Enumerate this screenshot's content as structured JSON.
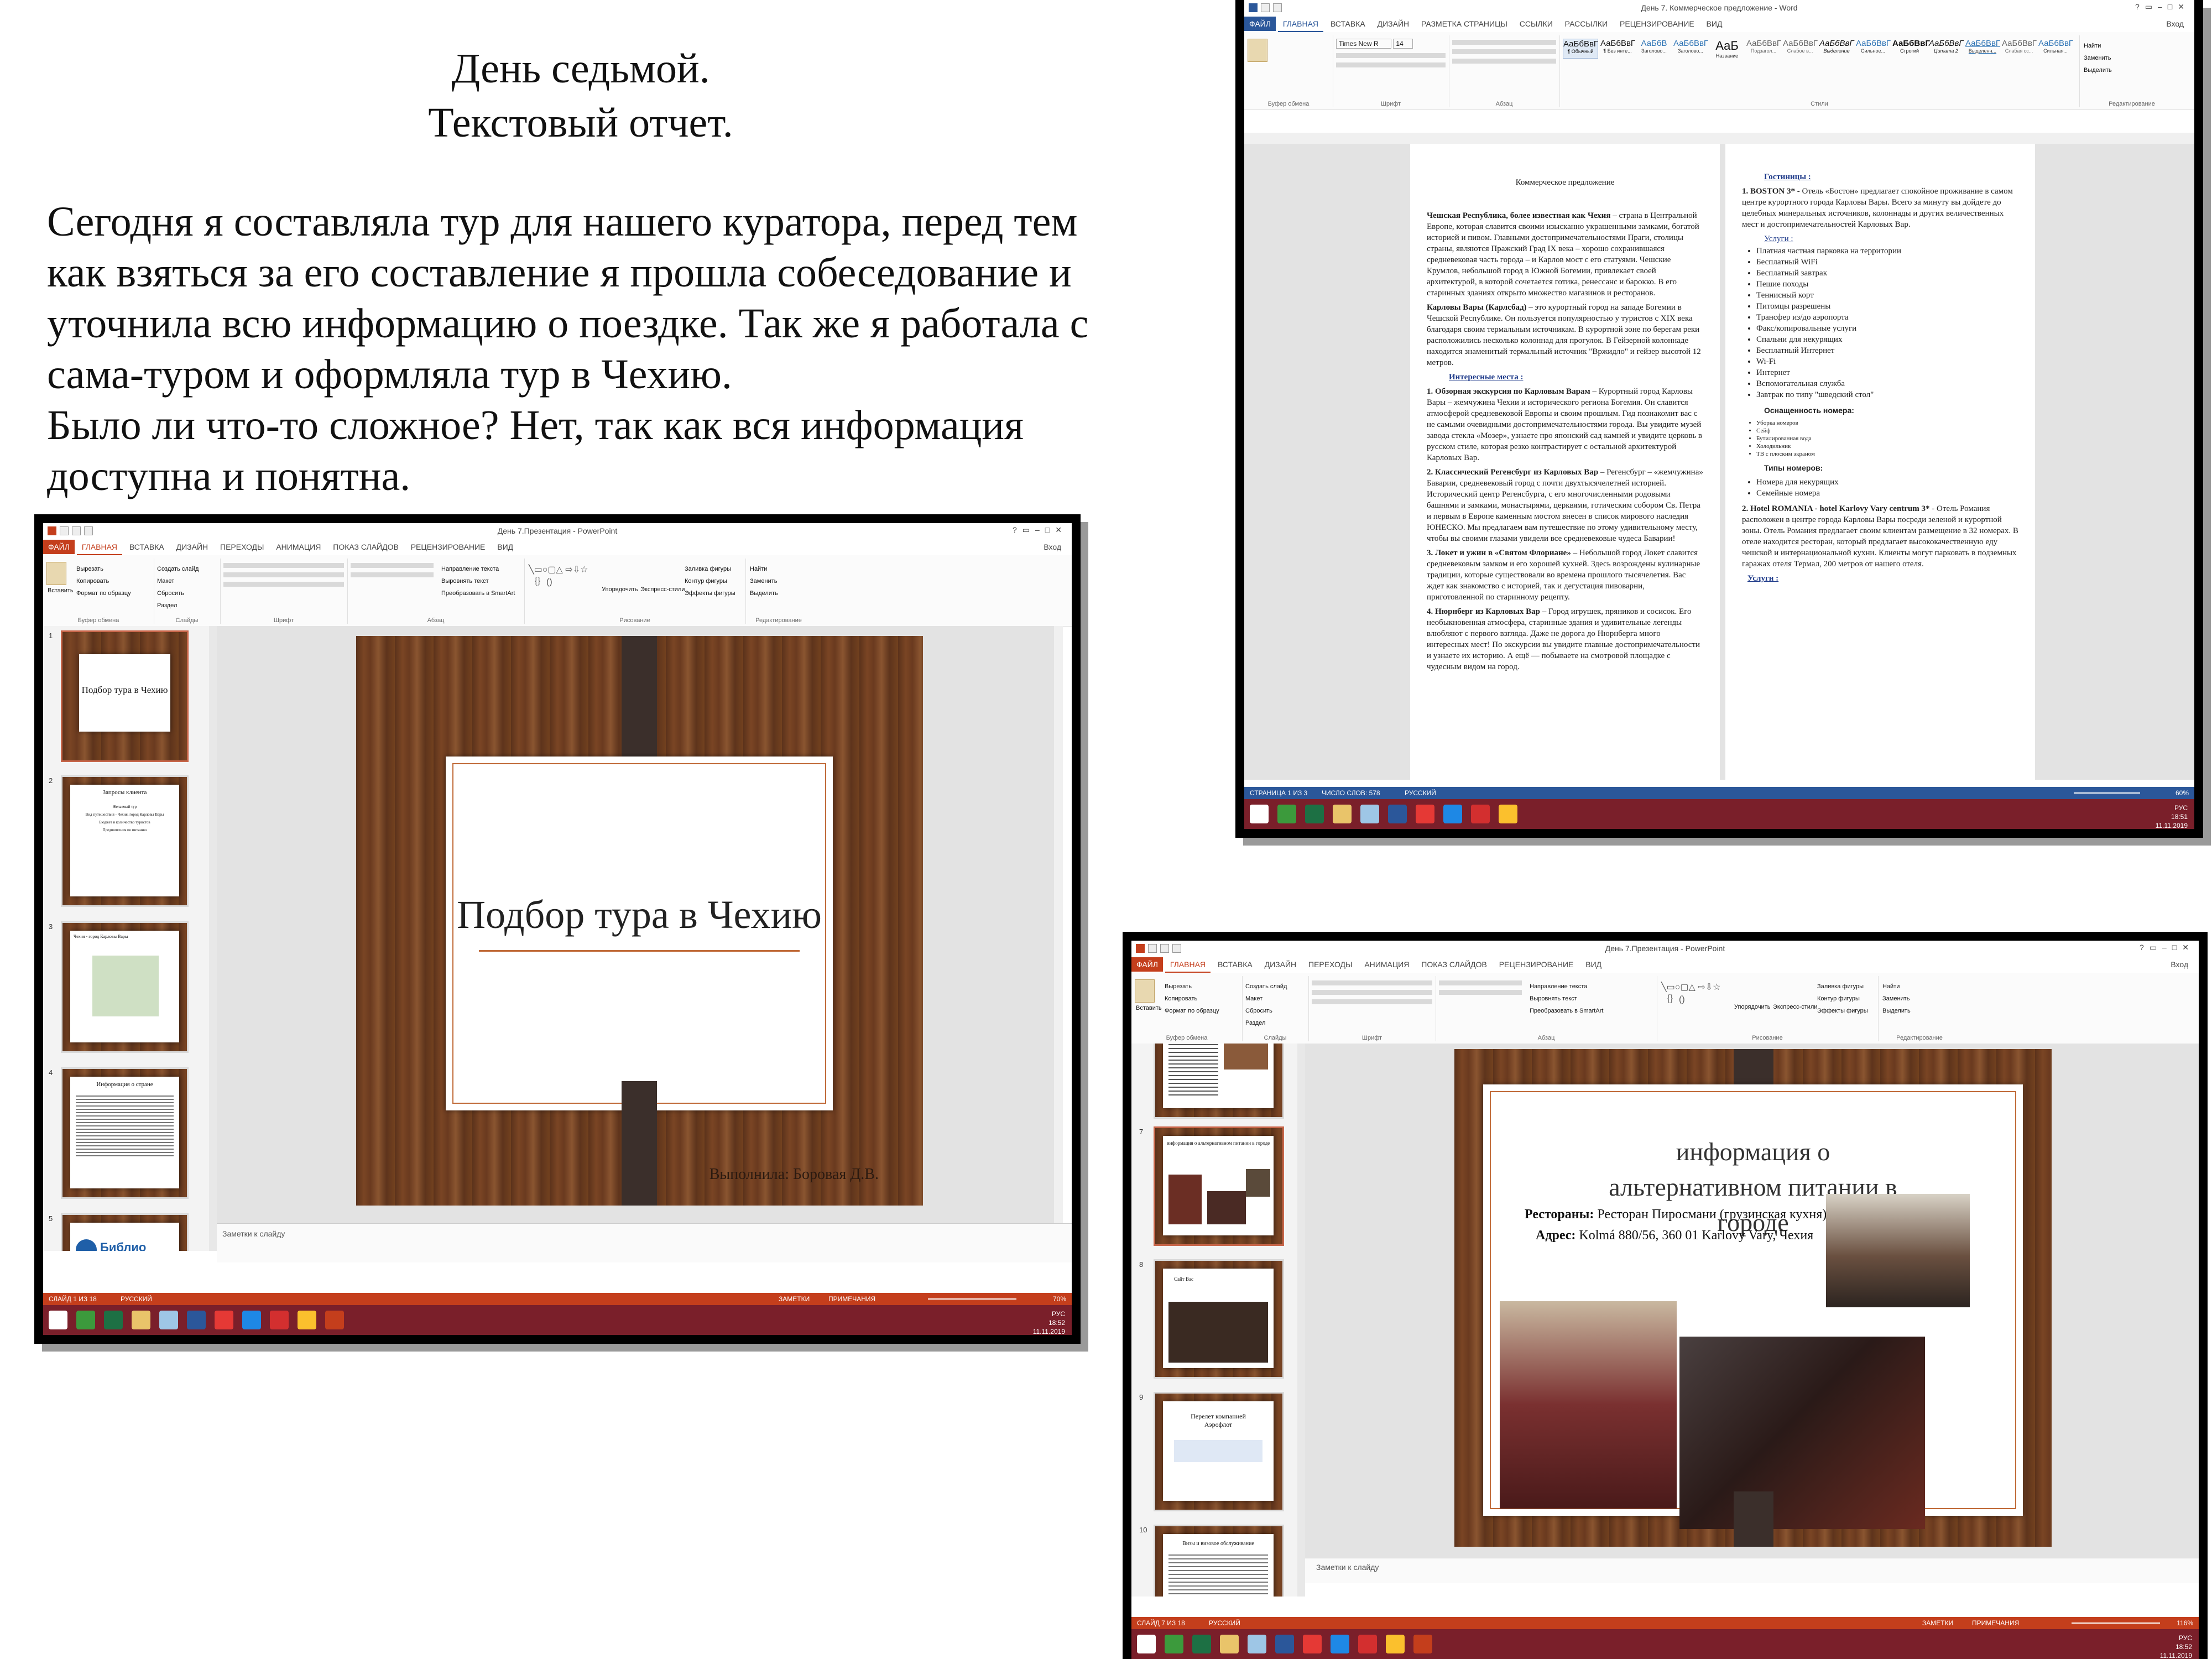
{
  "heading": {
    "line1": "День седьмой.",
    "line2": "Текстовый отчет."
  },
  "report": {
    "p1": "Сегодня я составляла тур для нашего куратора, перед тем как взяться за его составление я прошла собеседование и уточнила всю информацию о поездке. Так же я работала с сама-туром и оформляла тур в Чехию.",
    "p2": "Было ли что-то сложное? Нет, так как вся информация доступна и понятна."
  },
  "ppt1": {
    "window_title": "День 7.Презентация - PowerPoint",
    "tabs": [
      "ФАЙЛ",
      "ГЛАВНАЯ",
      "ВСТАВКА",
      "ДИЗАЙН",
      "ПЕРЕХОДЫ",
      "АНИМАЦИЯ",
      "ПОКАЗ СЛАЙДОВ",
      "РЕЦЕНЗИРОВАНИЕ",
      "ВИД"
    ],
    "login": "Вход",
    "ribbon_groups": [
      "Буфер обмена",
      "Слайды",
      "Шрифт",
      "Абзац",
      "Рисование",
      "Редактирование"
    ],
    "clipboard": [
      "Вставить",
      "Вырезать",
      "Копировать",
      "Формат по образцу"
    ],
    "slides_group": [
      "Создать слайд",
      "Макет",
      "Сбросить",
      "Раздел"
    ],
    "paragraph_group": [
      "Направление текста",
      "Выровнять текст",
      "Преобразовать в SmartArt"
    ],
    "drawing_group": [
      "Упорядочить",
      "Экспресс-стили",
      "Заливка фигуры",
      "Контур фигуры",
      "Эффекты фигуры"
    ],
    "editing_group": [
      "Найти",
      "Заменить",
      "Выделить"
    ],
    "thumbs": [
      {
        "num": "1",
        "title": "Подбор тура в Чехию"
      },
      {
        "num": "2",
        "title": "Запросы клиента"
      },
      {
        "num": "3",
        "title": "Чехия - город Карловы Вары"
      },
      {
        "num": "4",
        "title": "Информация о стране"
      },
      {
        "num": "5",
        "title": "Библио"
      }
    ],
    "thumb2_lines": [
      "Желаемый тур",
      "Вид путешествия - Чехия, город Карловы Вары",
      "Бюджет и количество туристов",
      "Предпочтения по питанию"
    ],
    "slide_title": "Подбор тура в Чехию",
    "slide_author": "Выполнила: Боровая Д.В.",
    "notes": "Заметки к слайду",
    "status_left": "СЛАЙД 1 ИЗ 18",
    "status_lang": "РУССКИЙ",
    "status_notes": "ЗАМЕТКИ",
    "status_comments": "ПРИМЕЧАНИЯ",
    "zoom": "70%",
    "clock_time": "18:52",
    "clock_date": "11.11.2019",
    "lang_indicator": "РУС"
  },
  "word": {
    "window_title": "День 7. Коммерческое предложение - Word",
    "tabs": [
      "ФАЙЛ",
      "ГЛАВНАЯ",
      "ВСТАВКА",
      "ДИЗАЙН",
      "РАЗМЕТКА СТРАНИЦЫ",
      "ССЫЛКИ",
      "РАССЫЛКИ",
      "РЕЦЕНЗИРОВАНИЕ",
      "ВИД"
    ],
    "login": "Вход",
    "font_name": "Times New R",
    "font_size": "14",
    "ribbon_groups": [
      "Буфер обмена",
      "Шрифт",
      "Абзац",
      "Стили",
      "Редактирование"
    ],
    "styles": [
      "АаБбВвГ",
      "АаБбВвГ",
      "АаБбВ",
      "АаБбВвГ",
      "АаБ",
      "АаБбВвГ",
      "АаБбВвГ",
      "АаБбВвГ",
      "АаБбВвГ",
      "АаБбВвГ",
      "АаБбВвГ",
      "АаБбВвГ",
      "АаБбВвГ",
      "АаБбВвГ"
    ],
    "style_names": [
      "¶ Обычный",
      "¶ Без инте...",
      "Заголово...",
      "Заголово...",
      "Название",
      "Подзагол...",
      "Слабое в...",
      "Выделение",
      "Сильное...",
      "Строгий",
      "Цитата 2",
      "Выделенн...",
      "Слабая сс...",
      "Сильная..."
    ],
    "editing": [
      "Найти",
      "Заменить",
      "Выделить"
    ],
    "left_page": {
      "heading": "Коммерческое предложение",
      "p1_bold": "Чешская Республика, более известная как Чехия",
      "p1": " – страна в Центральной Европе, которая славится своими изысканно украшенными замками, богатой историей и пивом. Главными достопримечательностями Праги, столицы страны, являются Пражский Град IX века – хорошо сохранившаяся средневековая часть города – и Карлов мост с его статуями. Чешские Крумлов, небольшой город в Южной Богемии, привлекает своей архитектурой, в которой сочетается готика, ренессанс и барокко. В его старинных зданиях открыто множество магазинов и ресторанов.",
      "p2_bold": "Карловы Вары (Карлсбад)",
      "p2": " – это курортный город на западе Богемии в Чешской Республике. Он пользуется популярностью у туристов с XIX века благодаря своим термальным источникам. В курортной зоне по берегам реки расположились несколько колоннад для прогулок. В Гейзерной колоннаде находится знаменитый термальный источник \"Вржидло\" и гейзер высотой 12 метров.",
      "places_heading": "Интересные места :",
      "place1_bold": "1. Обзорная экскурсия по Карловым Варам",
      "place1": " – Курортный город Карловы Вары – жемчужина Чехии и исторического региона Богемия. Он славится атмосферой средневековой Европы и своим прошлым. Гид познакомит вас с не самыми очевидными достопримечательностями города. Вы увидите музей завода стекла «Мозер», узнаете про японский сад камней и увидите церковь в русском стиле, которая резко контрастирует с остальной архитектурой Карловых Вар.",
      "place2_bold": "2. Классический Регенсбург из Карловых Вар",
      "place2": " – Регенсбург – «жемчужина» Баварии, средневековый город с почти двухтысячелетней историей. Исторический центр Регенсбурга, с его многочисленными родовыми башнями и замками, монастырями, церквями, готическим собором Св. Петра и первым в Европе каменным мостом внесен в список мирового наследия ЮНЕСКО. Мы предлагаем вам путешествие по этому удивительному месту, чтобы вы своими глазами увидели все средневековые чудеса Баварии!",
      "place3_bold": "3. Локет и ужин в «Святом Флориане»",
      "place3": " – Небольшой город Локет славится средневековым замком и его хорошей кухней. Здесь возрождены кулинарные традиции, которые существовали во времена прошлого тысячелетия. Вас ждет как знакомство с историей, так и дегустация пивоварни, приготовленной по старинному рецепту.",
      "place4_bold": "4. Нюрнберг из Карловых Вар",
      "place4": " – Город игрушек, пряников и сосисок. Его необыкновенная атмосфера, старинные здания и удивительные легенды влюбляют с первого взгляда. Даже не дорога до Нюрнберга много интересных мест! По экскурсии вы увидите главные достопримечательности и узнаете их историю. А ещё — побываете на смотровой площадке с чудесным видом на город."
    },
    "right_page": {
      "hotels_heading": "Гостиницы :",
      "h1_bold": "1. BOSTON 3*",
      "h1": " - Отель «Бостон» предлагает спокойное проживание в самом центре курортного города Карловы Вары. Всего за минуту вы дойдете до целебных минеральных источников, колоннады и других величественных мест и достопримечательностей Карловых Вар.",
      "services_heading": "Услуги :",
      "services": [
        "Платная частная парковка на территории",
        "Бесплатный WiFi",
        "Бесплатный завтрак",
        "Пешие походы",
        "Теннисный корт",
        "Питомцы разрешены",
        "Трансфер из/до аэропорта",
        "Факс/копировальные услуги",
        "Спальни для некурящих",
        "Бесплатный Интернет",
        "Wi-Fi",
        "Интернет",
        "Вспомогательная служба",
        "Завтрак по типу \"шведский стол\""
      ],
      "room_heading": "Оснащенность номера:",
      "room": [
        "Уборка номеров",
        "Сейф",
        "Бутилированная вода",
        "Холодильник",
        "ТВ с плоским экраном"
      ],
      "types_heading": "Типы номеров:",
      "types": [
        "Номера для некурящих",
        "Семейные номера"
      ],
      "h2_bold": "2. Hotel ROMANIA - hotel Karlovy Vary centrum 3*",
      "h2": " - Отель Романия расположен в центре города Карловы Вары посреди зеленой и курортной зоны. Отель Романия предлагает своим клиентам размещение в 32 номерах. В отеле находится ресторан, который предлагает высококачественную еду чешской и интернациональной кухни. Клиенты могут парковать в подземных гаражах отеля Термал, 200 метров от нашего отеля.",
      "trailing": "Услуги :"
    },
    "status_page": "СТРАНИЦА 1 ИЗ 3",
    "status_words": "ЧИСЛО СЛОВ: 578",
    "status_lang": "РУССКИЙ",
    "zoom": "60%",
    "clock_time": "18:51",
    "clock_date": "11.11.2019",
    "lang_indicator": "РУС"
  },
  "ppt2": {
    "window_title": "День 7.Презентация - PowerPoint",
    "tabs": [
      "ФАЙЛ",
      "ГЛАВНАЯ",
      "ВСТАВКА",
      "ДИЗАЙН",
      "ПЕРЕХОДЫ",
      "АНИМАЦИЯ",
      "ПОКАЗ СЛАЙДОВ",
      "РЕЦЕНЗИРОВАНИЕ",
      "ВИД"
    ],
    "login": "Вход",
    "ribbon_groups": [
      "Буфер обмена",
      "Слайды",
      "Шрифт",
      "Абзац",
      "Рисование",
      "Редактирование"
    ],
    "clipboard": [
      "Вставить",
      "Вырезать",
      "Копировать",
      "Формат по образцу"
    ],
    "slides_group": [
      "Создать слайд",
      "Макет",
      "Сбросить",
      "Раздел"
    ],
    "paragraph_group": [
      "Направление текста",
      "Выровнять текст",
      "Преобразовать в SmartArt"
    ],
    "drawing_group": [
      "Упорядочить",
      "Экспресс-стили",
      "Заливка фигуры",
      "Контур фигуры",
      "Эффекты фигуры"
    ],
    "editing_group": [
      "Найти",
      "Заменить",
      "Выделить"
    ],
    "thumbs": [
      {
        "num": "7",
        "title": "информация о альтернативном питании в городе"
      },
      {
        "num": "8",
        "title": "Сайт Вас"
      },
      {
        "num": "9",
        "title": "Перелет компанией Аэрофлот"
      },
      {
        "num": "10",
        "title": "Визы и визовое обслуживание"
      }
    ],
    "slide_title": "информация о альтернативном питании в городе",
    "restaurants_label": "Рестораны:",
    "restaurants_value": " Ресторан Пиросмани (грузинская кухня)",
    "address_label": "Адрес:",
    "address_value": " Kolmá 880/56, 360 01 Karlovy Vary, Чехия",
    "notes": "Заметки к слайду",
    "status_left": "СЛАЙД 7 ИЗ 18",
    "status_lang": "РУССКИЙ",
    "status_notes": "ЗАМЕТКИ",
    "status_comments": "ПРИМЕЧАНИЯ",
    "zoom": "116%",
    "clock_time": "18:52",
    "clock_date": "11.11.2019",
    "lang_indicator": "РУС"
  },
  "colors": {
    "ppt_accent": "#c43e1c",
    "word_accent": "#2b579a",
    "taskbar": "#7a1f2a",
    "slide_rule": "#c06a38"
  },
  "taskbar_icons": [
    "start-icon",
    "tasks-icon",
    "excel-icon",
    "explorer-icon",
    "files-icon",
    "word-icon",
    "yandex-icon",
    "ie-icon",
    "opera-icon",
    "chrome-icon",
    "powerpoint-icon"
  ]
}
